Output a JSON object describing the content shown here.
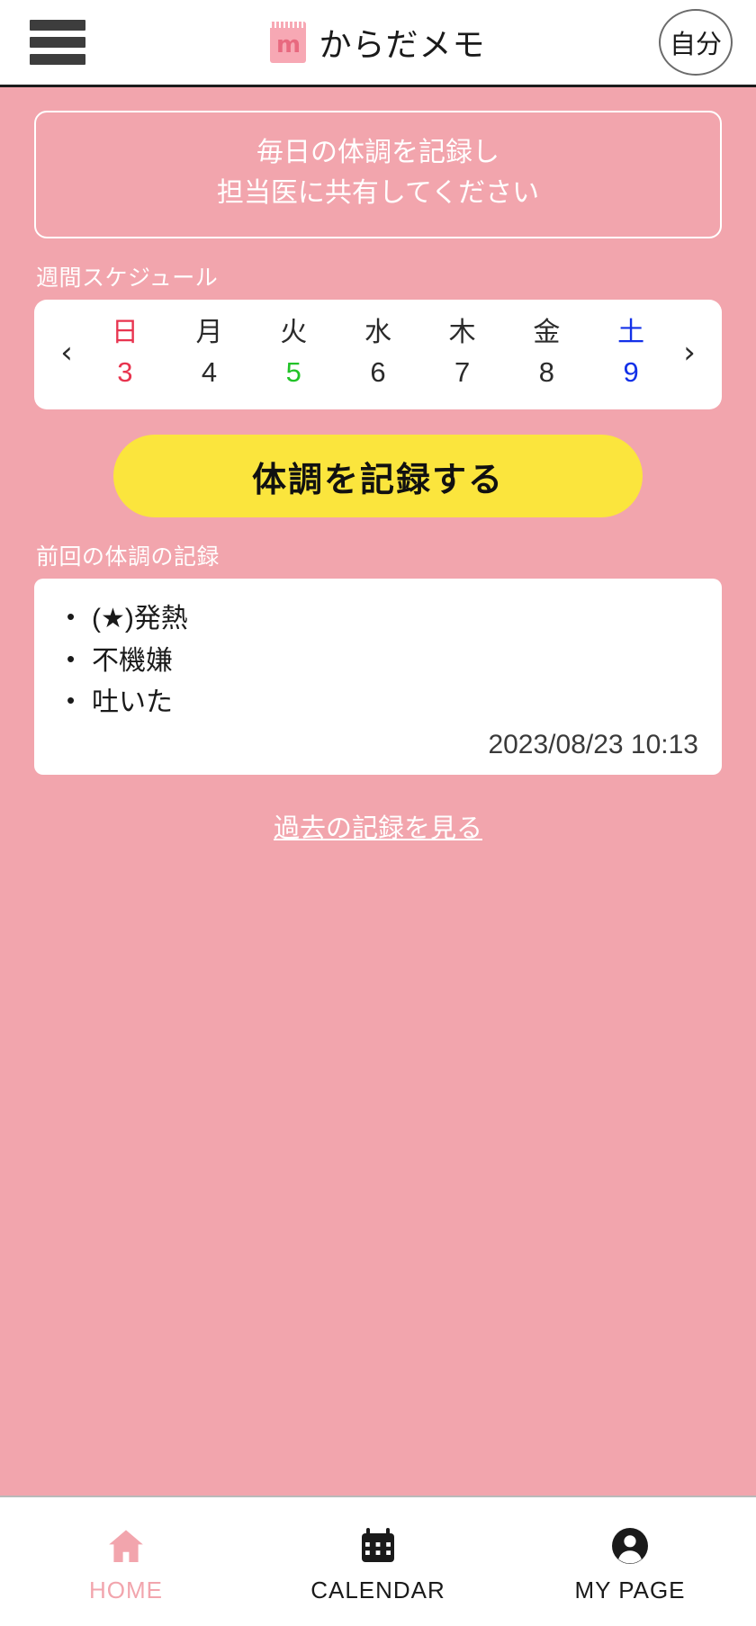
{
  "header": {
    "menu_icon": "hamburger-menu-icon",
    "logo_icon": "notepad-logo-icon",
    "logo_glyph": "m",
    "title": "からだメモ",
    "profile_label": "自分"
  },
  "notice": {
    "line1": "毎日の体調を記録し",
    "line2": "担当医に共有してください"
  },
  "schedule": {
    "label": "週間スケジュール",
    "prev_arrow": "‹",
    "next_arrow": "›",
    "days": [
      {
        "name": "日",
        "num": "3",
        "name_color": "#e8344f",
        "num_color": "#e8344f"
      },
      {
        "name": "月",
        "num": "4",
        "name_color": "#2b2b2b",
        "num_color": "#2b2b2b"
      },
      {
        "name": "火",
        "num": "5",
        "name_color": "#2b2b2b",
        "num_color": "#22c328"
      },
      {
        "name": "水",
        "num": "6",
        "name_color": "#2b2b2b",
        "num_color": "#2b2b2b"
      },
      {
        "name": "木",
        "num": "7",
        "name_color": "#2b2b2b",
        "num_color": "#2b2b2b"
      },
      {
        "name": "金",
        "num": "8",
        "name_color": "#2b2b2b",
        "num_color": "#2b2b2b"
      },
      {
        "name": "土",
        "num": "9",
        "name_color": "#1230e8",
        "num_color": "#1230e8"
      }
    ]
  },
  "record_button": {
    "label": "体調を記録する",
    "bg_color": "#fbe53d"
  },
  "last_record": {
    "label": "前回の体調の記録",
    "items": [
      "(★)発熱",
      "不機嫌",
      "吐いた"
    ],
    "timestamp": "2023/08/23 10:13"
  },
  "history_link": {
    "label": "過去の記録を見る"
  },
  "bottom_nav": {
    "items": [
      {
        "label": "HOME",
        "icon": "home-icon",
        "active": true
      },
      {
        "label": "CALENDAR",
        "icon": "calendar-icon",
        "active": false
      },
      {
        "label": "MY PAGE",
        "icon": "person-icon",
        "active": false
      }
    ]
  },
  "theme": {
    "background_pink": "#f2a5ad",
    "accent_yellow": "#fbe53d",
    "card_white": "#ffffff"
  }
}
